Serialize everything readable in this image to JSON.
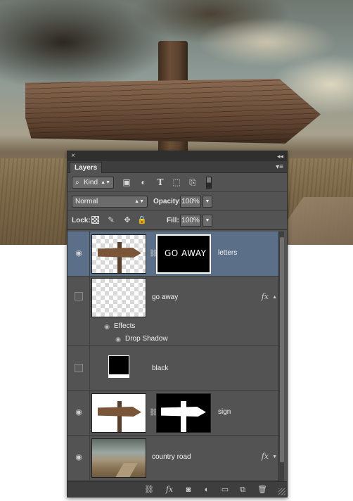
{
  "panel": {
    "close_glyph": "×",
    "collapse_glyph": "◂◂",
    "tab_label": "Layers",
    "menu_glyph": "▾≡"
  },
  "filter": {
    "kind_label": "Kind",
    "icons": [
      "image-filter-icon",
      "adjustment-filter-icon",
      "type-filter-icon",
      "shape-filter-icon",
      "smart-object-filter-icon"
    ]
  },
  "blend": {
    "mode": "Normal",
    "opacity_label": "Opacity:",
    "opacity_value": "100%"
  },
  "lock": {
    "label": "Lock:",
    "fill_label": "Fill:",
    "fill_value": "100%"
  },
  "layers": [
    {
      "name": "letters",
      "visible": true,
      "selected": true,
      "mask_text": "GO AWAY"
    },
    {
      "name": "go away",
      "visible": false,
      "selected": false,
      "has_fx": true,
      "effects_label": "Effects",
      "effect_items": [
        "Drop Shadow"
      ]
    },
    {
      "name": "black",
      "visible": false,
      "selected": false
    },
    {
      "name": "sign",
      "visible": true,
      "selected": false
    },
    {
      "name": "country road",
      "visible": true,
      "selected": false,
      "has_fx": true
    }
  ],
  "fx_label": "fx",
  "footer_icons": [
    "link-layers-icon",
    "fx-icon",
    "add-mask-icon",
    "adjustment-layer-icon",
    "new-group-icon",
    "new-layer-icon",
    "trash-icon"
  ],
  "colors": {
    "panel_bg": "#535353",
    "selected_row": "#5b6f89"
  }
}
